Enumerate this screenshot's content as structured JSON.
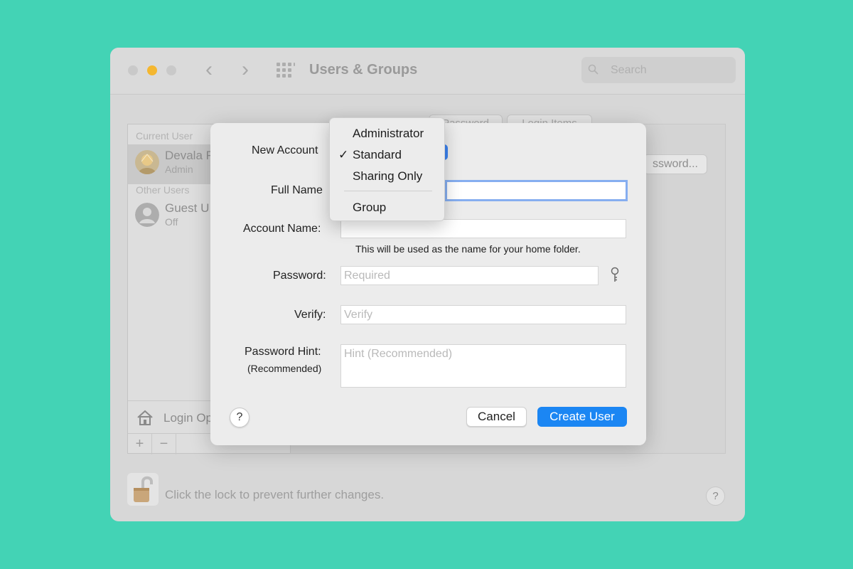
{
  "window": {
    "title": "Users & Groups",
    "search_placeholder": "Search"
  },
  "sidebar": {
    "current_user_header": "Current User",
    "current_user": {
      "name": "Devala R",
      "role": "Admin"
    },
    "other_users_header": "Other Users",
    "other_users": [
      {
        "name": "Guest U",
        "role": "Off"
      }
    ],
    "login_options_label": "Login Op",
    "add_label": "+",
    "remove_label": "−"
  },
  "right_panel": {
    "tabs": [
      "Password",
      "Login Items"
    ],
    "change_password_label": "ssword..."
  },
  "footer": {
    "lock_text": "Click the lock to prevent further changes.",
    "help_label": "?"
  },
  "sheet": {
    "new_account_label": "New Account",
    "full_name_label": "Full Name",
    "full_name_value": "",
    "account_name_label": "Account Name:",
    "account_name_value": "",
    "account_name_note": "This will be used as the name for your home folder.",
    "password_label": "Password:",
    "password_placeholder": "Required",
    "verify_label": "Verify:",
    "verify_placeholder": "Verify",
    "hint_label": "Password Hint:",
    "hint_sublabel": "(Recommended)",
    "hint_placeholder": "Hint (Recommended)",
    "help_label": "?",
    "cancel_label": "Cancel",
    "create_label": "Create User"
  },
  "account_type_menu": {
    "items": [
      "Administrator",
      "Standard",
      "Sharing Only"
    ],
    "extra_item": "Group",
    "selected": "Standard",
    "check_mark": "✓"
  },
  "colors": {
    "background": "#43d3b5",
    "accent": "#1b86f3",
    "focus_ring": "#86aef0",
    "minimize_light": "#f4b730"
  }
}
